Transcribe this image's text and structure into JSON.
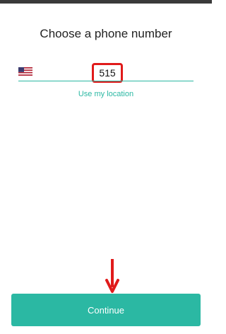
{
  "screen": {
    "title": "Choose a phone number"
  },
  "phone": {
    "country_flag": "us-flag-icon",
    "value": "515"
  },
  "location_link": "Use my location",
  "continue_label": "Continue",
  "colors": {
    "accent": "#2bb8a3",
    "highlight": "#e01b1b"
  }
}
